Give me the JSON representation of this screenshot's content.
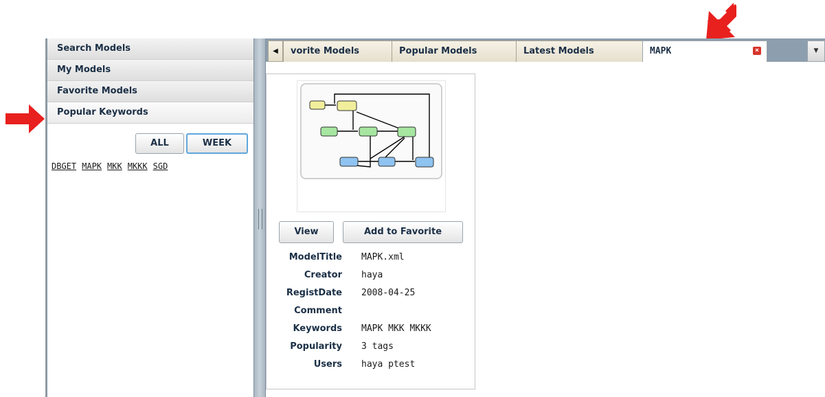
{
  "accordion": {
    "items": [
      {
        "label": "Search Models"
      },
      {
        "label": "My Models"
      },
      {
        "label": "Favorite Models"
      },
      {
        "label": "Popular Keywords"
      }
    ]
  },
  "keyword_period": {
    "all_label": "ALL",
    "week_label": "WEEK",
    "selected": "WEEK"
  },
  "keywords": [
    "DBGET",
    "MAPK",
    "MKK",
    "MKKK",
    "SGD"
  ],
  "tabs": {
    "items": [
      {
        "label": "vorite Models"
      },
      {
        "label": "Popular Models"
      },
      {
        "label": "Latest Models"
      },
      {
        "label": "MAPK"
      }
    ],
    "active": "MAPK"
  },
  "model": {
    "view_label": "View",
    "add_favorite_label": "Add to Favorite",
    "fields": [
      {
        "label": "ModelTitle",
        "value": "MAPK.xml"
      },
      {
        "label": "Creator",
        "value": "haya"
      },
      {
        "label": "RegistDate",
        "value": "2008-04-25"
      },
      {
        "label": "Comment",
        "value": ""
      },
      {
        "label": "Keywords",
        "value": "MAPK MKK MKKK"
      },
      {
        "label": "Popularity",
        "value": "3 tags"
      },
      {
        "label": "Users",
        "value": "haya ptest"
      }
    ]
  },
  "colors": {
    "arrow": "#e8201e",
    "tab_bar": "#8d9eae",
    "close": "#d9342b"
  }
}
